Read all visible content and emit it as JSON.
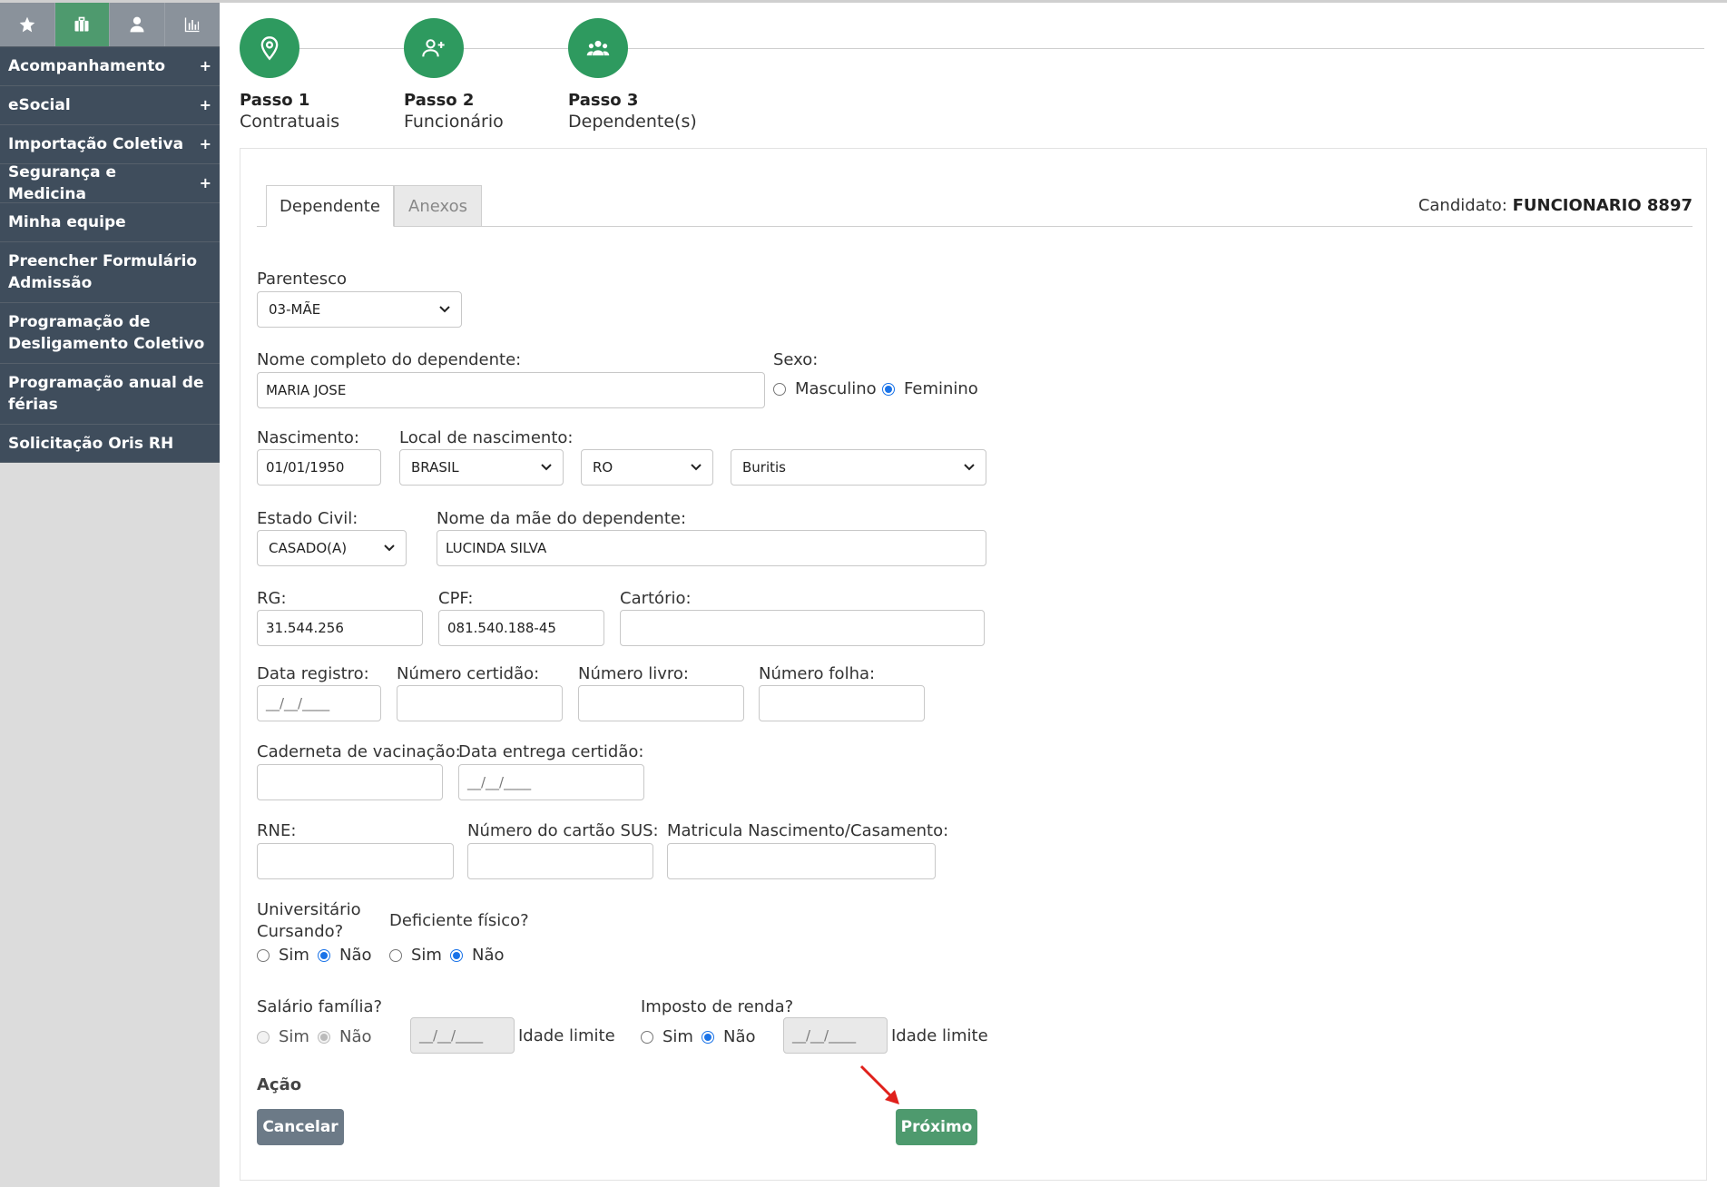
{
  "sidebar": {
    "tabs": [
      {
        "icon": "star-icon"
      },
      {
        "icon": "briefcase-icon"
      },
      {
        "icon": "user-icon"
      },
      {
        "icon": "bar-chart-icon"
      }
    ],
    "items": [
      {
        "label": "Acompanhamento",
        "plus": "+"
      },
      {
        "label": "eSocial",
        "plus": "+"
      },
      {
        "label": "Importação Coletiva",
        "plus": "+"
      },
      {
        "label": "Segurança e Medicina",
        "plus": "+"
      },
      {
        "label": "Minha equipe"
      },
      {
        "label1": "Preencher Formulário",
        "label2": "Admissão"
      },
      {
        "label1": "Programação de",
        "label2": "Desligamento Coletivo"
      },
      {
        "label1": "Programação anual de",
        "label2": "férias"
      },
      {
        "label": "Solicitação Oris RH"
      }
    ]
  },
  "stepper": {
    "steps": [
      {
        "title": "Passo 1",
        "subtitle": "Contratuais",
        "icon": "location-pin-icon"
      },
      {
        "title": "Passo 2",
        "subtitle": "Funcionário",
        "icon": "user-plus-icon"
      },
      {
        "title": "Passo 3",
        "subtitle": "Dependente(s)",
        "icon": "users-group-icon"
      }
    ]
  },
  "tabs": {
    "dependente": "Dependente",
    "anexos": "Anexos"
  },
  "candidate": {
    "label": "Candidato:",
    "name": "FUNCIONARIO 8897"
  },
  "form": {
    "parentesco": {
      "label": "Parentesco",
      "value": "03-MÃE"
    },
    "nome": {
      "label": "Nome completo do dependente:",
      "value": "MARIA JOSE"
    },
    "sexo": {
      "label": "Sexo:",
      "masculino": "Masculino",
      "feminino": "Feminino",
      "selected": "Feminino"
    },
    "nascimento": {
      "label": "Nascimento:",
      "value": "01/01/1950"
    },
    "local": {
      "label": "Local de nascimento:",
      "pais": "BRASIL",
      "uf": "RO",
      "cidade": "Buritis"
    },
    "estado_civil": {
      "label": "Estado Civil:",
      "value": "CASADO(A)"
    },
    "nome_mae": {
      "label": "Nome da mãe do dependente:",
      "value": "LUCINDA SILVA"
    },
    "rg": {
      "label": "RG:",
      "value": "31.544.256"
    },
    "cpf": {
      "label": "CPF:",
      "value": "081.540.188-45"
    },
    "cartorio": {
      "label": "Cartório:",
      "value": ""
    },
    "data_registro": {
      "label": "Data registro:",
      "placeholder": "__/__/____"
    },
    "numero_certidao": {
      "label": "Número certidão:",
      "value": ""
    },
    "numero_livro": {
      "label": "Número livro:",
      "value": ""
    },
    "numero_folha": {
      "label": "Número folha:",
      "value": ""
    },
    "caderneta": {
      "label": "Caderneta de vacinação:",
      "value": ""
    },
    "data_entrega": {
      "label": "Data entrega certidão:",
      "placeholder": "__/__/____"
    },
    "rne": {
      "label": "RNE:",
      "value": ""
    },
    "sus": {
      "label": "Número do cartão SUS:",
      "value": ""
    },
    "matricula": {
      "label": "Matricula Nascimento/Casamento:",
      "value": ""
    },
    "universitario": {
      "label1": "Universitário",
      "label2": "Cursando?",
      "sim": "Sim",
      "nao": "Não",
      "selected": "Não"
    },
    "deficiente": {
      "label": "Deficiente físico?",
      "sim": "Sim",
      "nao": "Não",
      "selected": "Não"
    },
    "salario_familia": {
      "label": "Salário família?",
      "sim": "Sim",
      "nao": "Não",
      "selected": "Não",
      "placeholder": "__/__/____",
      "idade": "Idade limite"
    },
    "imposto_renda": {
      "label": "Imposto de renda?",
      "sim": "Sim",
      "nao": "Não",
      "selected": "Não",
      "placeholder": "__/__/____",
      "idade": "Idade limite"
    }
  },
  "acao": {
    "label": "Ação",
    "cancelar": "Cancelar",
    "proximo": "Próximo"
  },
  "colors": {
    "accent_green": "#4e9a6e",
    "step_green": "#2e9a5f",
    "sidebar_dark": "#3f4d5c",
    "radio_blue": "#1a73e8",
    "annotation_red": "#e0201b"
  }
}
